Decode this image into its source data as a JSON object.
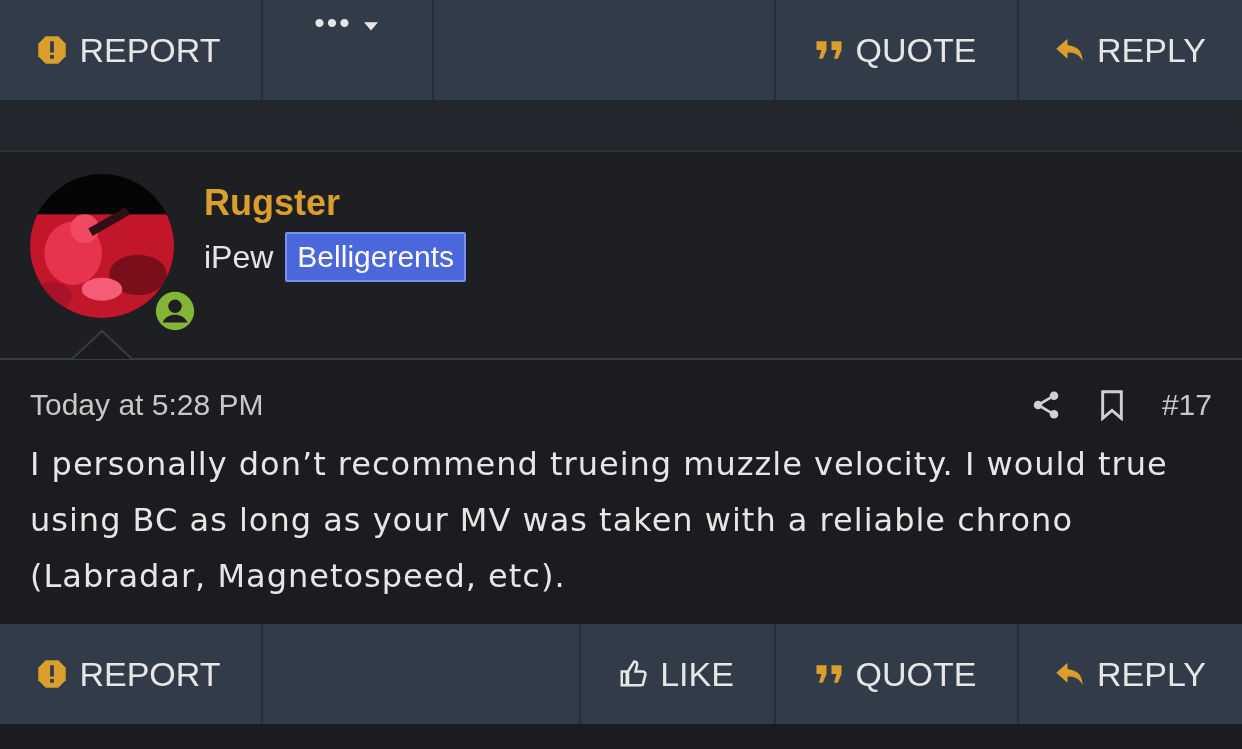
{
  "top_actions": [
    {
      "kind": "report",
      "label": "REPORT"
    },
    {
      "kind": "more",
      "label": "•••"
    },
    {
      "kind": "spacer"
    },
    {
      "kind": "quote",
      "label": "QUOTE"
    },
    {
      "kind": "reply",
      "label": "REPLY"
    }
  ],
  "post": {
    "author": "Rugster",
    "title": "iPew",
    "badge": "Belligerents",
    "online": true,
    "time": "Today at 5:28 PM",
    "number": "#17",
    "body": "I personally don’t recommend trueing muzzle velocity. I would true using BC as long as your MV was taken with a reliable chrono (Labradar, Magnetospeed, etc)."
  },
  "bottom_actions": [
    {
      "kind": "report",
      "label": "REPORT"
    },
    {
      "kind": "spacer"
    },
    {
      "kind": "like",
      "label": "LIKE"
    },
    {
      "kind": "quote",
      "label": "QUOTE"
    },
    {
      "kind": "reply",
      "label": "REPLY"
    }
  ]
}
